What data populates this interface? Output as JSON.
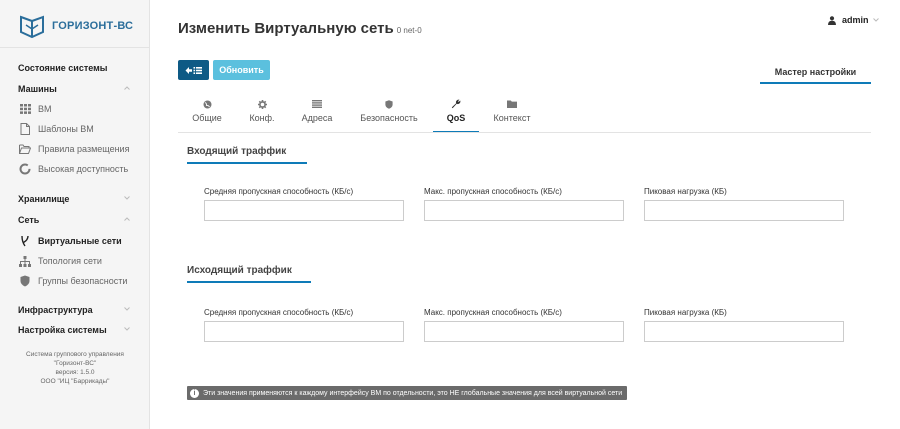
{
  "brand": {
    "name": "ГОРИЗОНТ-ВС"
  },
  "header": {
    "title": "Изменить Виртуальную сеть",
    "subtitle": "0 net-0",
    "user": "admin"
  },
  "sidebar": {
    "system_status": "Состояние системы",
    "machines": "Машины",
    "vm": "ВМ",
    "vm_templates": "Шаблоны ВМ",
    "placement_rules": "Правила размещения",
    "high_availability": "Высокая доступность",
    "storage": "Хранилище",
    "network": "Сеть",
    "virtual_networks": "Виртуальные сети",
    "network_topology": "Топология сети",
    "security_groups": "Группы безопасности",
    "infrastructure": "Инфраструктура",
    "system_settings": "Настройка системы",
    "footer": [
      "Система группового управления",
      "\"Горизонт-ВС\"",
      "версия: 1.5.0",
      "ООО \"ИЦ \"Баррикады\""
    ]
  },
  "toolbar": {
    "update_label": "Обновить",
    "wizard_label": "Мастер настройки"
  },
  "tabs": [
    {
      "label": "Общие",
      "icon": "globe-icon"
    },
    {
      "label": "Конф.",
      "icon": "gear-icon"
    },
    {
      "label": "Адреса",
      "icon": "list-icon"
    },
    {
      "label": "Безопасность",
      "icon": "shield-icon"
    },
    {
      "label": "QoS",
      "icon": "wrench-icon",
      "active": true
    },
    {
      "label": "Контекст",
      "icon": "folder-icon"
    }
  ],
  "inbound": {
    "title": "Входящий траффик",
    "avg_label": "Средняя пропускная способность (КБ/с)",
    "max_label": "Макс. пропускная способность (КБ/с)",
    "peak_label": "Пиковая нагрузка (КБ)",
    "avg_value": "",
    "max_value": "",
    "peak_value": ""
  },
  "outbound": {
    "title": "Исходящий траффик",
    "avg_label": "Средняя пропускная способность (КБ/с)",
    "max_label": "Макс. пропускная способность (КБ/с)",
    "peak_label": "Пиковая нагрузка (КБ)",
    "avg_value": "",
    "max_value": "",
    "peak_value": ""
  },
  "note": {
    "icon": "i",
    "text": "Эти значения применяются к каждому интерфейсу ВМ по отдельности, это НЕ глобальные значения для всей виртуальной сети"
  },
  "colors": {
    "accent": "#0e7bb8",
    "primary": "#0e5a85",
    "info": "#5bc0de",
    "note_bg": "#6b6b6b"
  }
}
